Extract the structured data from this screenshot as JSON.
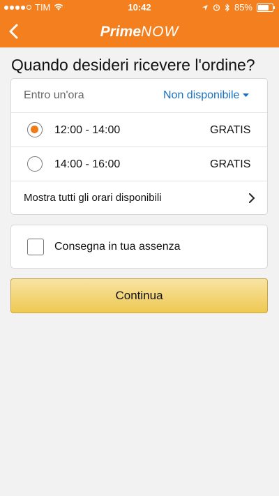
{
  "status_bar": {
    "carrier": "TIM",
    "time": "10:42",
    "battery": "85%",
    "battery_level": 0.85,
    "icons": [
      "signal-dots-icon",
      "wifi-icon",
      "location-icon",
      "alarm-icon",
      "bluetooth-icon",
      "battery-icon"
    ]
  },
  "nav": {
    "back_icon": "chevron-left-icon",
    "logo_prime": "Prime",
    "logo_now": "NOW"
  },
  "page": {
    "title": "Quando desideri ricevere l'ordine?"
  },
  "delivery": {
    "within_hour_label": "Entro un'ora",
    "within_hour_value": "Non disponibile",
    "slots": [
      {
        "time": "12:00 - 14:00",
        "price": "GRATIS",
        "selected": true
      },
      {
        "time": "14:00 - 16:00",
        "price": "GRATIS",
        "selected": false
      }
    ],
    "show_all_label": "Mostra tutti gli orari disponibili"
  },
  "unattended": {
    "label": "Consegna in tua assenza",
    "checked": false
  },
  "continue_button": "Continua",
  "colors": {
    "brand_orange": "#f47f1e",
    "link_blue": "#1a6fc1",
    "button_gold": "#efc952"
  }
}
